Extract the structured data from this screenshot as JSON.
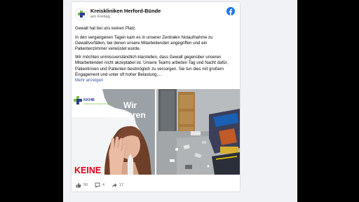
{
  "post": {
    "page_name": "Kreiskliniken Herford-Bünde",
    "timestamp": "am Freitag",
    "headline": "Gewalt hat bei uns keinen Platz.",
    "paragraph_1": "In den vergangenen Tagen kam es in unserer Zentralen Notaufnahme zu Gewaltvorfällen, bei denen unsere Mitarbeitenden angegriffen und ein Patientenzimmer verwüstet wurde.",
    "paragraph_2": "Wir möchten unmissverständlich klarstellen, dass Gewalt gegenüber unseren Mitarbeitenden nicht akzeptabel ist. Unsere Teams arbeiten Tag und Nacht dafür, Patientinnen und Patienten bestmöglich zu versorgen. Sie tun dies mit großem Engagement und unter oft hoher Belastung....",
    "see_more": "Mehr anzeigen"
  },
  "poster": {
    "logo_text": "KKHB",
    "logo_subtext": "KREISKLINIKEN HERFORD-BÜNDE",
    "line_1": "Wir",
    "line_2": "tolerieren",
    "bottom_word": "KEINE"
  },
  "stats": {
    "reactions": "50",
    "comments": "4",
    "shares": "17"
  },
  "icons": {
    "brand": "facebook-icon",
    "reaction": "thumbs-up-icon",
    "comment": "comment-icon",
    "share": "share-icon"
  },
  "colors": {
    "facebook_blue": "#1877f2",
    "poster_red": "#e3001b",
    "poster_blue": "#2f3f8f",
    "poster_green": "#7cc243",
    "link": "#385898"
  }
}
